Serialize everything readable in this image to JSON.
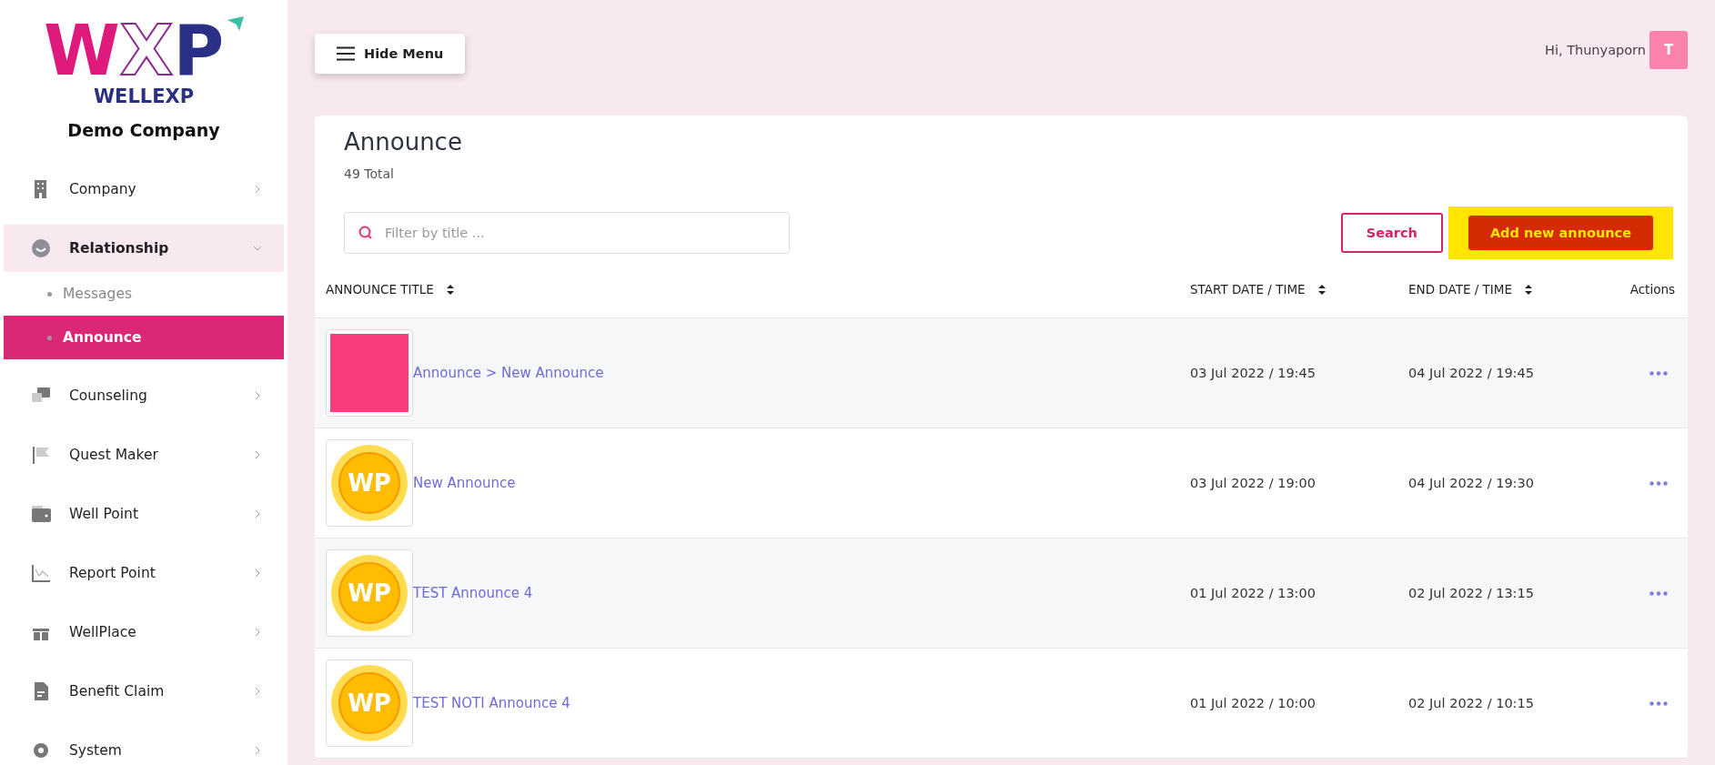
{
  "logo": {
    "letters": [
      {
        "text": "W",
        "outlined": false
      },
      {
        "text": "X",
        "outlined": true
      },
      {
        "text": "P",
        "outlined": false
      }
    ],
    "wordmark": "WELLEXP"
  },
  "company": "Demo Company",
  "sidebar": {
    "items": [
      {
        "label": "Company",
        "selected": false,
        "expanded": false
      },
      {
        "label": "Relationship",
        "selected": true,
        "expanded": true,
        "children": [
          {
            "label": "Messages",
            "selected": false
          },
          {
            "label": "Announce",
            "selected": true
          }
        ]
      },
      {
        "label": "Counseling",
        "selected": false,
        "expanded": false
      },
      {
        "label": "Quest Maker",
        "selected": false,
        "expanded": false
      },
      {
        "label": "Well Point",
        "selected": false,
        "expanded": false
      },
      {
        "label": "Report Point",
        "selected": false,
        "expanded": false
      },
      {
        "label": "WellPlace",
        "selected": false,
        "expanded": false
      },
      {
        "label": "Benefit Claim",
        "selected": false,
        "expanded": false
      },
      {
        "label": "System",
        "selected": false,
        "expanded": false
      }
    ]
  },
  "topbar": {
    "menu_button": "Hide Menu",
    "greeting": "Hi, Thunyaporn",
    "avatar": "T"
  },
  "page": {
    "title": "Announce",
    "total": "49 Total"
  },
  "search": {
    "placeholder": "Filter by title ...",
    "button": "Search"
  },
  "add_button": {
    "label": "Add new announce",
    "highlighted": true
  },
  "table": {
    "columns": [
      {
        "label": "ANNOUNCE TITLE",
        "sortable": true
      },
      {
        "label": "START DATE / TIME",
        "sortable": true
      },
      {
        "label": "END DATE / TIME",
        "sortable": true
      },
      {
        "label": "Actions",
        "sortable": false
      }
    ],
    "rows": [
      {
        "thumbnail": {
          "kind": "photo"
        },
        "title": "Announce > New Announce",
        "start": "03 Jul 2022 / 19:45",
        "end": "04 Jul 2022 / 19:45"
      },
      {
        "thumbnail": {
          "kind": "coin",
          "label": "WP"
        },
        "title": "New Announce",
        "start": "03 Jul 2022 / 19:00",
        "end": "04 Jul 2022 / 19:30"
      },
      {
        "thumbnail": {
          "kind": "coin",
          "label": "WP"
        },
        "title": "TEST Announce 4",
        "start": "01 Jul 2022 / 13:00",
        "end": "02 Jul 2022 / 13:15"
      },
      {
        "thumbnail": {
          "kind": "coin",
          "label": "WP"
        },
        "title": "TEST NOTI Announce 4",
        "start": "01 Jul 2022 / 10:00",
        "end": "02 Jul 2022 / 10:15"
      }
    ]
  }
}
